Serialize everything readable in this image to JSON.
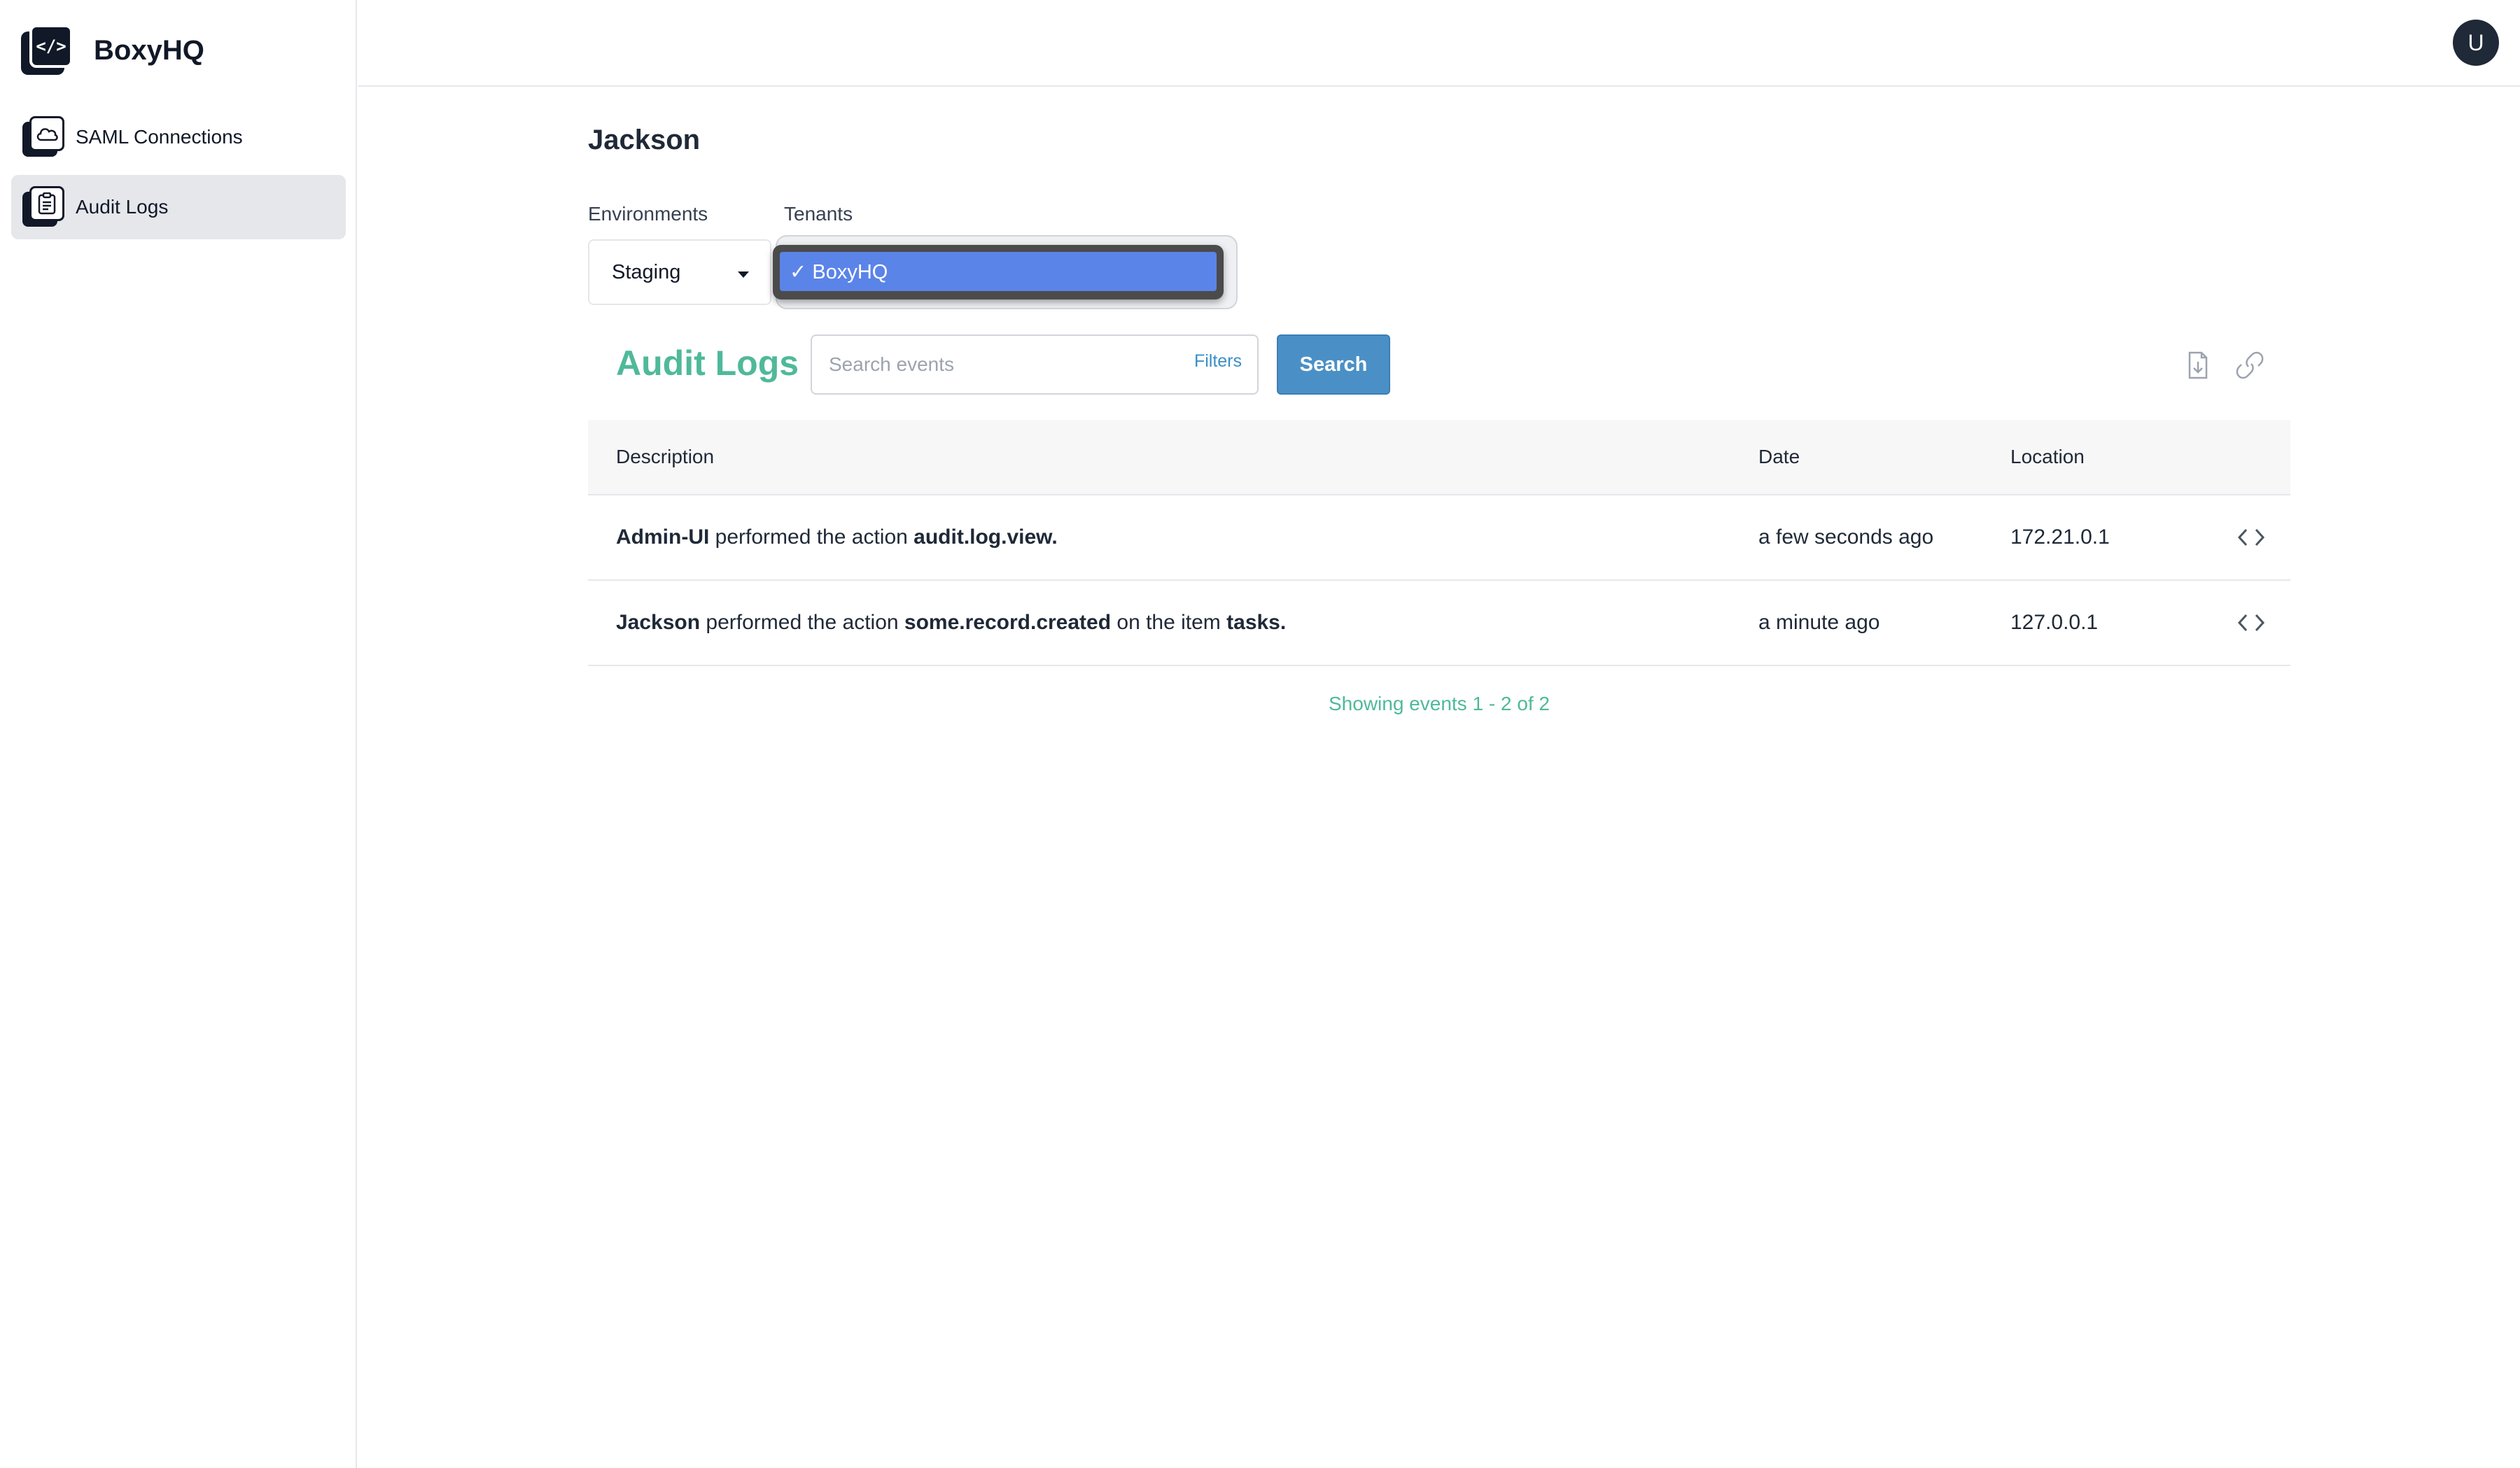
{
  "brand": {
    "name": "BoxyHQ",
    "logo_glyph": "</>"
  },
  "sidebar": {
    "items": [
      {
        "label": "SAML Connections",
        "icon": "cloud-icon",
        "active": false
      },
      {
        "label": "Audit Logs",
        "icon": "clipboard-icon",
        "active": true
      }
    ]
  },
  "header": {
    "avatar_initial": "U"
  },
  "page": {
    "title": "Jackson"
  },
  "filters": {
    "environments_label": "Environments",
    "environment_value": "Staging",
    "tenants_label": "Tenants",
    "tenant_option": "✓ BoxyHQ"
  },
  "audit": {
    "heading": "Audit Logs",
    "search_placeholder": "Search events",
    "filters_label": "Filters",
    "search_button": "Search"
  },
  "table": {
    "headers": {
      "description": "Description",
      "date": "Date",
      "location": "Location"
    },
    "rows": [
      {
        "actor": "Admin-UI",
        "text1": " performed the action ",
        "action": "audit.log.view.",
        "text2": "",
        "target": "",
        "date": "a few seconds ago",
        "location": "172.21.0.1"
      },
      {
        "actor": "Jackson",
        "text1": " performed the action ",
        "action": "some.record.created",
        "text2": " on the item ",
        "target": "tasks.",
        "date": "a minute ago",
        "location": "127.0.0.1"
      }
    ]
  },
  "pagination": {
    "prefix": "Showing events ",
    "range": "1 - 2",
    "of": " of ",
    "total": "2"
  },
  "colors": {
    "accent": "#4fb99a",
    "primary": "#4a90c6",
    "selected": "#5b84e9"
  }
}
